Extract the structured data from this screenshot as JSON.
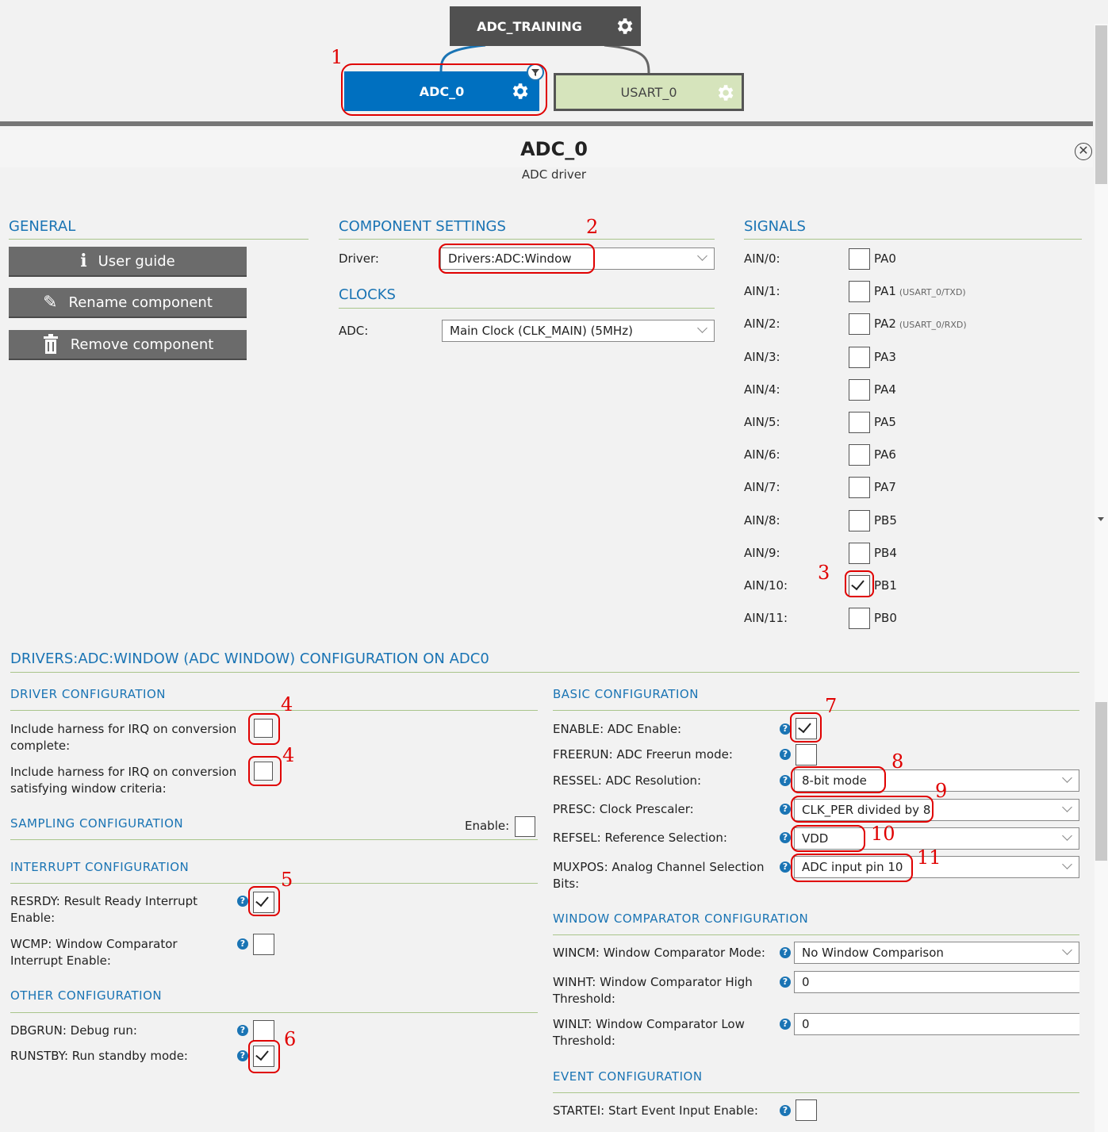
{
  "graph": {
    "root": "ADC_TRAINING",
    "adc_node": "ADC_0",
    "usart_node": "USART_0"
  },
  "header": {
    "title": "ADC_0",
    "subtitle": "ADC driver"
  },
  "general": {
    "heading": "GENERAL",
    "user_guide": "User guide",
    "rename": "Rename component",
    "remove": "Remove component"
  },
  "component_settings": {
    "heading": "COMPONENT SETTINGS",
    "driver_label": "Driver:",
    "driver_value": "Drivers:ADC:Window"
  },
  "clocks": {
    "heading": "CLOCKS",
    "adc_label": "ADC:",
    "adc_value": "Main Clock (CLK_MAIN) (5MHz)"
  },
  "signals": {
    "heading": "SIGNALS",
    "rows": [
      {
        "label": "AIN/0:",
        "pin": "PA0",
        "note": "",
        "checked": false
      },
      {
        "label": "AIN/1:",
        "pin": "PA1",
        "note": "(USART_0/TXD)",
        "checked": false
      },
      {
        "label": "AIN/2:",
        "pin": "PA2",
        "note": "(USART_0/RXD)",
        "checked": false
      },
      {
        "label": "AIN/3:",
        "pin": "PA3",
        "note": "",
        "checked": false
      },
      {
        "label": "AIN/4:",
        "pin": "PA4",
        "note": "",
        "checked": false
      },
      {
        "label": "AIN/5:",
        "pin": "PA5",
        "note": "",
        "checked": false
      },
      {
        "label": "AIN/6:",
        "pin": "PA6",
        "note": "",
        "checked": false
      },
      {
        "label": "AIN/7:",
        "pin": "PA7",
        "note": "",
        "checked": false
      },
      {
        "label": "AIN/8:",
        "pin": "PB5",
        "note": "",
        "checked": false
      },
      {
        "label": "AIN/9:",
        "pin": "PB4",
        "note": "",
        "checked": false
      },
      {
        "label": "AIN/10:",
        "pin": "PB1",
        "note": "",
        "checked": true
      },
      {
        "label": "AIN/11:",
        "pin": "PB0",
        "note": "",
        "checked": false
      }
    ]
  },
  "config": {
    "heading": "DRIVERS:ADC:WINDOW (ADC WINDOW) CONFIGURATION ON ADC0",
    "driver_cfg": {
      "heading": "DRIVER CONFIGURATION",
      "irq_complete_1": "Include harness for IRQ on conversion",
      "irq_complete_2": "complete:",
      "irq_window_1": "Include harness for IRQ on conversion",
      "irq_window_2": "satisfying window criteria:"
    },
    "sampling": {
      "heading": "SAMPLING CONFIGURATION",
      "enable": "Enable:"
    },
    "interrupt": {
      "heading": "INTERRUPT CONFIGURATION",
      "resrdy_1": "RESRDY: Result Ready Interrupt",
      "resrdy_2": "Enable:",
      "wcmp_1": "WCMP: Window Comparator",
      "wcmp_2": "Interrupt Enable:"
    },
    "other": {
      "heading": "OTHER CONFIGURATION",
      "dbgrun": "DBGRUN: Debug run:",
      "runstby": "RUNSTBY: Run standby mode:"
    },
    "basic": {
      "heading": "BASIC CONFIGURATION",
      "enable": "ENABLE: ADC Enable:",
      "freerun": "FREERUN: ADC Freerun mode:",
      "ressel": "RESSEL: ADC Resolution:",
      "ressel_value": "8-bit mode",
      "presc": "PRESC: Clock Prescaler:",
      "presc_value": "CLK_PER divided by 8",
      "refsel": "REFSEL: Reference Selection:",
      "refsel_value": "VDD",
      "muxpos_1": "MUXPOS: Analog Channel Selection",
      "muxpos_2": "Bits:",
      "muxpos_value": "ADC input pin 10"
    },
    "window": {
      "heading": "WINDOW COMPARATOR CONFIGURATION",
      "wincm": "WINCM: Window Comparator Mode:",
      "wincm_value": "No Window Comparison",
      "winht_1": "WINHT: Window Comparator High",
      "winht_2": "Threshold:",
      "winht_value": "0",
      "winlt_1": "WINLT: Window Comparator Low",
      "winlt_2": "Threshold:",
      "winlt_value": "0"
    },
    "event": {
      "heading": "EVENT CONFIGURATION",
      "startei": "STARTEI: Start Event Input Enable:"
    }
  },
  "annotations": [
    "1",
    "2",
    "3",
    "4",
    "4",
    "5",
    "6",
    "7",
    "8",
    "9",
    "10",
    "11"
  ],
  "colors": {
    "adc_node": "#0070c0",
    "usart_node": "#d6e4bc",
    "root_node": "#505050",
    "heading_blue": "#1a74b4",
    "annotation_red": "#e00000"
  }
}
